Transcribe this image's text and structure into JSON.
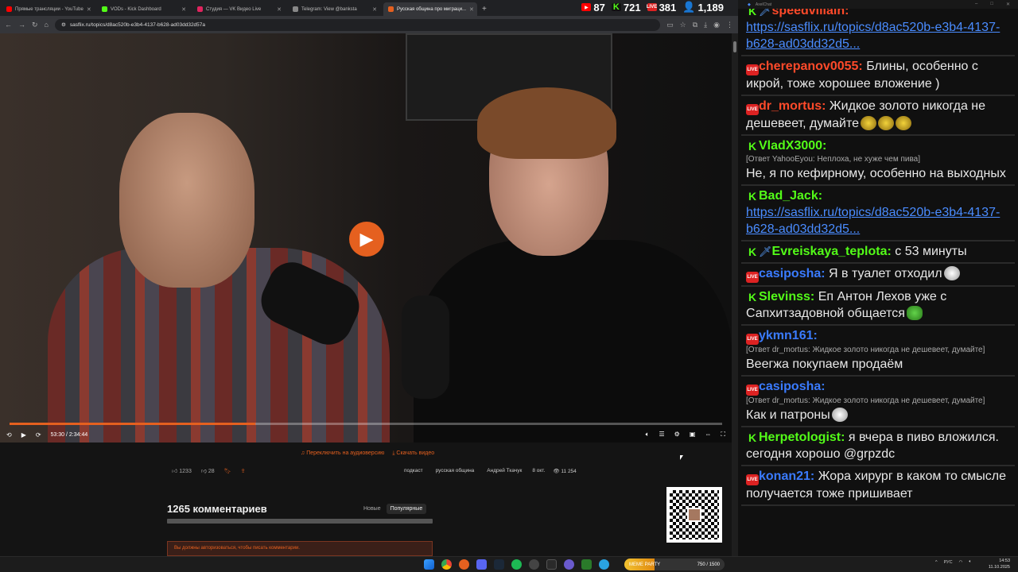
{
  "browser": {
    "tabs": [
      {
        "label": "Прямые трансляции - YouTube",
        "color": "#ff0000",
        "active": false
      },
      {
        "label": "VODs - Kick Dashboard",
        "color": "#53fc18",
        "active": false
      },
      {
        "label": "Студия — VK Видео Live",
        "color": "#e0245e",
        "active": false
      },
      {
        "label": "Telegram: View @banksta",
        "color": "#888888",
        "active": false
      },
      {
        "label": "Русская община про миграци...",
        "color": "#e5601f",
        "active": true
      }
    ],
    "url": "sasflix.ru/topics/d8ac520b-e3b4-4137-b628-ad03dd32d57a"
  },
  "stats": {
    "youtube": "87",
    "kick": "721",
    "vk": "381",
    "total": "1,189"
  },
  "player": {
    "time": "53:30 / 2:34:44",
    "progress": 0.345
  },
  "page": {
    "audio_link": "Переключить на аудиоверсию",
    "download_link": "Скачать видео",
    "likes": "1233",
    "dislikes": "28",
    "tags": [
      "подкаст",
      "русская община",
      "Андрей Ткачук"
    ],
    "date": "8 окт.",
    "views": "11 254",
    "comments_count": "1265 комментариев",
    "comment_tabs": [
      "Новые",
      "Популярные"
    ],
    "auth_notice": "Вы должны авторизоваться, чтобы писать комментарии."
  },
  "chat": {
    "window_title": "AxelChat",
    "messages": [
      {
        "platform": "kick",
        "user": "speedvillain:",
        "color": "u-red",
        "sword": true,
        "text": "",
        "link": "https://sasflix.ru/topics/d8ac520b-e3b4-4137-b628-ad03dd32d5...",
        "reply": ""
      },
      {
        "platform": "vk",
        "user": "cherepanov0055:",
        "color": "u-red",
        "text": "Блины, особенно с икрой, тоже хорошее вложение )",
        "reply": ""
      },
      {
        "platform": "vk",
        "user": "dr_mortus:",
        "color": "u-red",
        "text": "Жидкое золото никогда не дешевеет, думайте",
        "emotes": 3,
        "reply": ""
      },
      {
        "platform": "kick",
        "user": "VladX3000:",
        "color": "u-green",
        "reply": "[Ответ YahooEyou: Неплоха, не хуже чем пива]",
        "text": "Не, я по кефирному, особенно на выходных"
      },
      {
        "platform": "kick",
        "user": "Bad_Jack:",
        "color": "u-green",
        "link": "https://sasflix.ru/topics/d8ac520b-e3b4-4137-b628-ad03dd32d5...",
        "text": "",
        "reply": ""
      },
      {
        "platform": "kick",
        "user": "Evreiskaya_teplota:",
        "color": "u-green",
        "sword": true,
        "text": "с 53 минуты",
        "reply": ""
      },
      {
        "platform": "vk",
        "user": "casiposha:",
        "color": "u-blue",
        "text": "Я в туалет отходил",
        "emote_w": true,
        "reply": ""
      },
      {
        "platform": "kick",
        "user": "Slevinss:",
        "color": "u-green",
        "text": "Еп Антон Лехов уже с Сапхитзадовной общается",
        "emote_g": true,
        "reply": ""
      },
      {
        "platform": "vk",
        "user": "ykmn161:",
        "color": "u-blue",
        "reply": "[Ответ dr_mortus: Жидкое золото никогда не дешевеет, думайте]",
        "text": "Веегжа покупаем продаём"
      },
      {
        "platform": "vk",
        "user": "casiposha:",
        "color": "u-blue",
        "reply": "[Ответ dr_mortus: Жидкое золото никогда не дешевеет, думайте]",
        "text": "Как и патроны",
        "emote_w": true
      },
      {
        "platform": "kick",
        "user": "Herpetologist:",
        "color": "u-green",
        "text": "я вчера в пиво вложился. сегодня хорошо @grpzdc",
        "reply": ""
      },
      {
        "platform": "vk",
        "user": "konan21:",
        "color": "u-blue",
        "text": "Жора хирург в каком то смысле получается тоже пришивает",
        "reply": ""
      }
    ]
  },
  "taskbar": {
    "meme_label": "MEME PARTY",
    "meme_count": "750 / 1500",
    "lang": "РУС",
    "time": "14:53",
    "date": "11.10.2025"
  }
}
